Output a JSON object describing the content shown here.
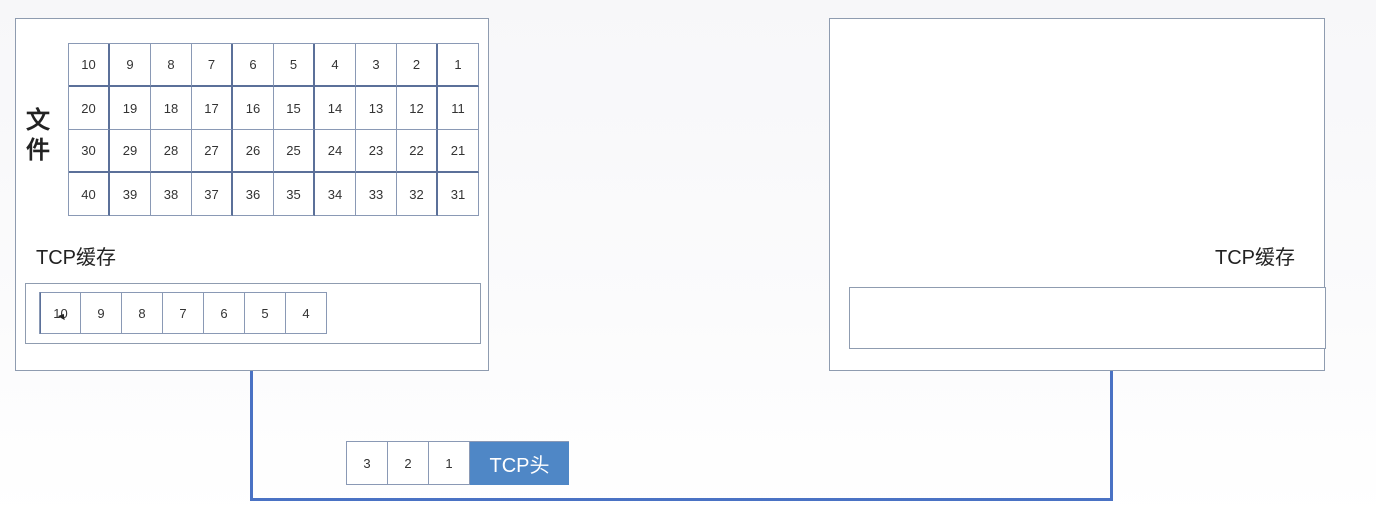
{
  "left_host": {
    "file_label": "文件",
    "file_rows": [
      [
        "10",
        "9",
        "8",
        "7",
        "6",
        "5",
        "4",
        "3",
        "2",
        "1"
      ],
      [
        "20",
        "19",
        "18",
        "17",
        "16",
        "15",
        "14",
        "13",
        "12",
        "11"
      ],
      [
        "30",
        "29",
        "28",
        "27",
        "26",
        "25",
        "24",
        "23",
        "22",
        "21"
      ],
      [
        "40",
        "39",
        "38",
        "37",
        "36",
        "35",
        "34",
        "33",
        "32",
        "31"
      ]
    ],
    "tcp_buffer_label": "TCP缓存",
    "buffer_segments": [
      "10",
      "9",
      "8",
      "7",
      "6",
      "5",
      "4"
    ]
  },
  "right_host": {
    "tcp_buffer_label": "TCP缓存",
    "buffer_segments": []
  },
  "packet": {
    "segments": [
      "3",
      "2",
      "1"
    ],
    "header_label": "TCP头"
  },
  "colors": {
    "wire": "#4a72c4",
    "header_fill": "#4f87c6",
    "cell_border": "#8a99b5"
  },
  "icons": [
    "mouse-pointer-icon"
  ]
}
